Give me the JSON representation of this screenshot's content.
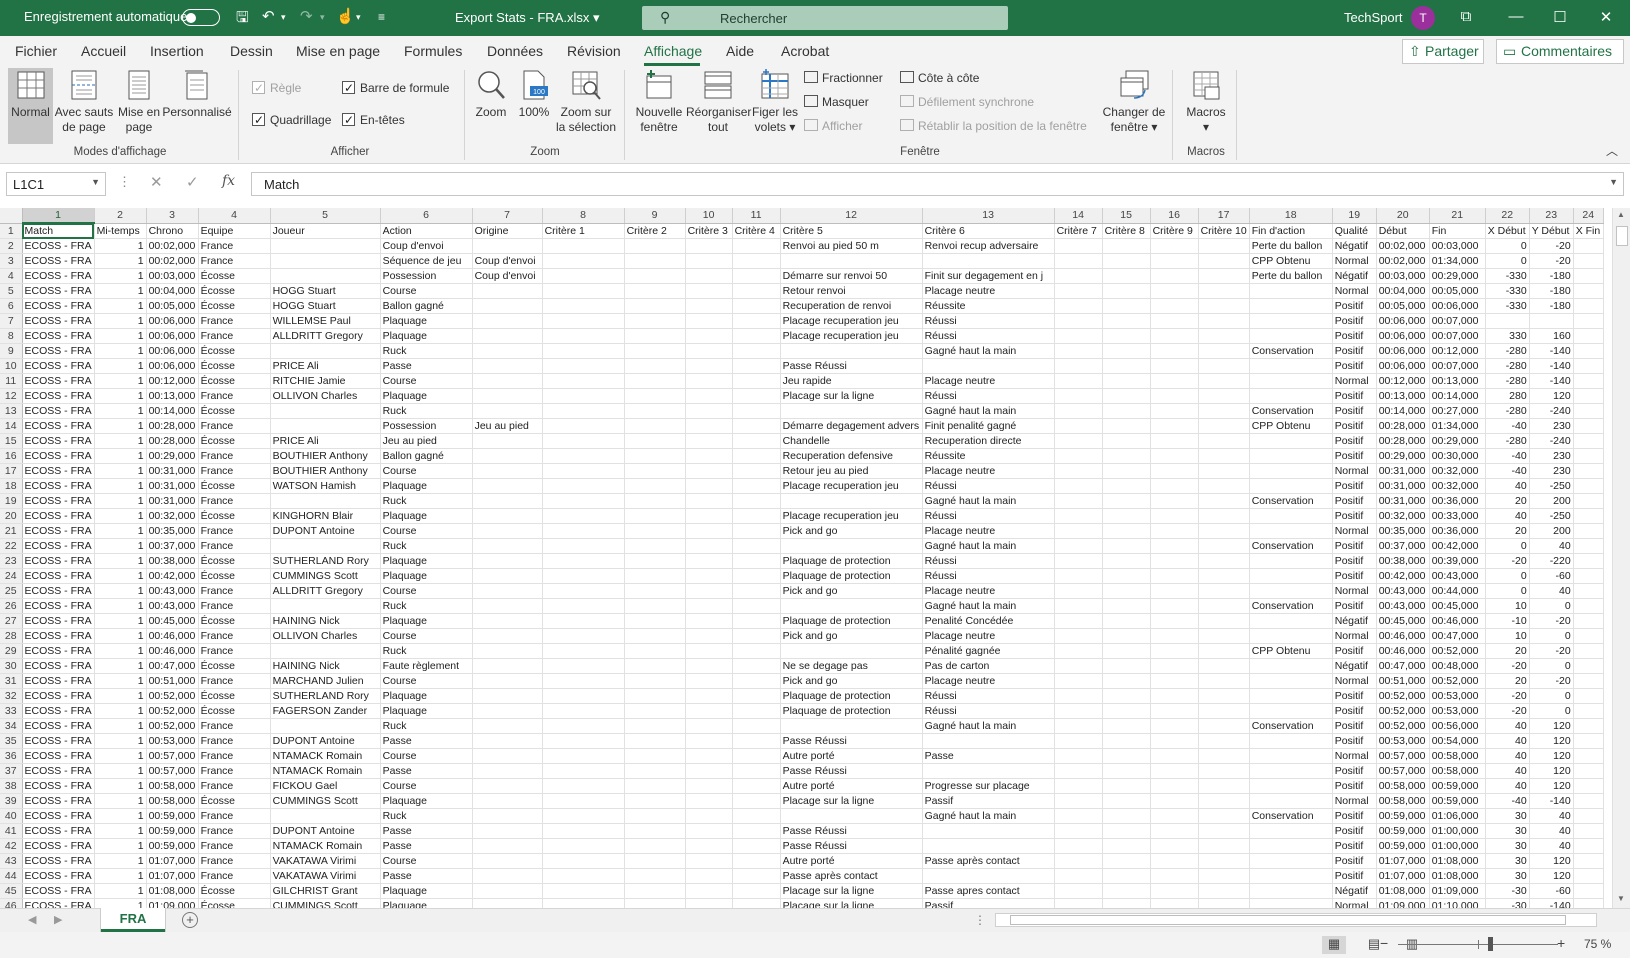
{
  "titlebar": {
    "autosave_label": "Enregistrement automatique",
    "filename": "Export Stats - FRA.xlsx",
    "search_placeholder": "Rechercher",
    "user_name": "TechSport",
    "avatar_initial": "T"
  },
  "tabs": [
    "Fichier",
    "Accueil",
    "Insertion",
    "Dessin",
    "Mise en page",
    "Formules",
    "Données",
    "Révision",
    "Affichage",
    "Aide",
    "Acrobat"
  ],
  "active_tab": "Affichage",
  "share_label": "Partager",
  "comments_label": "Commentaires",
  "ribbon": {
    "modes": {
      "normal": "Normal",
      "page_break_1": "Avec sauts",
      "page_break_2": "de page",
      "layout_1": "Mise en",
      "layout_2": "page",
      "custom": "Personnalisé",
      "group": "Modes d'affichage"
    },
    "show": {
      "regle": "Règle",
      "barre": "Barre de formule",
      "quadrillage": "Quadrillage",
      "entetes": "En-têtes",
      "group": "Afficher"
    },
    "zoom": {
      "zoom": "Zoom",
      "hundred": "100%",
      "selection_1": "Zoom sur",
      "selection_2": "la sélection",
      "group": "Zoom"
    },
    "window": {
      "new_1": "Nouvelle",
      "new_2": "fenêtre",
      "arrange_1": "Réorganiser",
      "arrange_2": "tout",
      "freeze_1": "Figer les",
      "freeze_2": "volets",
      "split": "Fractionner",
      "hide": "Masquer",
      "unhide": "Afficher",
      "side": "Côte à côte",
      "sync": "Défilement synchrone",
      "reset": "Rétablir la position de la fenêtre",
      "switch_1": "Changer de",
      "switch_2": "fenêtre",
      "group": "Fenêtre"
    },
    "macros": {
      "label": "Macros",
      "group": "Macros"
    }
  },
  "formula_bar": {
    "name_box": "L1C1",
    "value": "Match"
  },
  "columns": [
    "1",
    "2",
    "3",
    "4",
    "5",
    "6",
    "7",
    "8",
    "9",
    "10",
    "11",
    "12",
    "13",
    "14",
    "15",
    "16",
    "17",
    "18",
    "19",
    "20",
    "21",
    "22",
    "23",
    "24"
  ],
  "rows": [
    [
      "Match",
      "Mi-temps",
      "Chrono",
      "Equipe",
      "Joueur",
      "Action",
      "Origine",
      "Critère 1",
      "Critère 2",
      "Critère 3",
      "Critère 4",
      "Critère 5",
      "Critère 6",
      "Critère 7",
      "Critère 8",
      "Critère 9",
      "Critère 10",
      "Fin d'action",
      "Qualité",
      "Début",
      "Fin",
      "X Début",
      "Y Début",
      "X Fin"
    ],
    [
      "ECOSS - FRA",
      "1",
      "00:02,000",
      "France",
      "",
      "Coup d'envoi",
      "",
      "",
      "",
      "",
      "",
      "Renvoi au pied 50 m",
      "Renvoi recup adversaire",
      "",
      "",
      "",
      "",
      "Perte du ballon",
      "Négatif",
      "00:02,000",
      "00:03,000",
      "0",
      "-20",
      ""
    ],
    [
      "ECOSS - FRA",
      "1",
      "00:02,000",
      "France",
      "",
      "Séquence de jeu",
      "Coup d'envoi",
      "",
      "",
      "",
      "",
      "",
      "",
      "",
      "",
      "",
      "",
      "CPP Obtenu",
      "Normal",
      "00:02,000",
      "01:34,000",
      "0",
      "-20",
      ""
    ],
    [
      "ECOSS - FRA",
      "1",
      "00:03,000",
      "Écosse",
      "",
      "Possession",
      "Coup d'envoi",
      "",
      "",
      "",
      "",
      "Démarre sur renvoi 50",
      "Finit sur degagement en j",
      "",
      "",
      "",
      "",
      "Perte du ballon",
      "Négatif",
      "00:03,000",
      "00:29,000",
      "-330",
      "-180",
      ""
    ],
    [
      "ECOSS - FRA",
      "1",
      "00:04,000",
      "Écosse",
      "HOGG Stuart",
      "Course",
      "",
      "",
      "",
      "",
      "",
      "Retour renvoi",
      "Placage neutre",
      "",
      "",
      "",
      "",
      "",
      "Normal",
      "00:04,000",
      "00:05,000",
      "-330",
      "-180",
      ""
    ],
    [
      "ECOSS - FRA",
      "1",
      "00:05,000",
      "Écosse",
      "HOGG Stuart",
      "Ballon gagné",
      "",
      "",
      "",
      "",
      "",
      "Recuperation de renvoi",
      "Réussite",
      "",
      "",
      "",
      "",
      "",
      "Positif",
      "00:05,000",
      "00:06,000",
      "-330",
      "-180",
      ""
    ],
    [
      "ECOSS - FRA",
      "1",
      "00:06,000",
      "France",
      "WILLEMSE Paul",
      "Plaquage",
      "",
      "",
      "",
      "",
      "",
      "Placage recuperation jeu",
      "Réussi",
      "",
      "",
      "",
      "",
      "",
      "Positif",
      "00:06,000",
      "00:07,000",
      "",
      ""
    ],
    [
      "ECOSS - FRA",
      "1",
      "00:06,000",
      "France",
      "ALLDRITT Gregory",
      "Plaquage",
      "",
      "",
      "",
      "",
      "",
      "Placage recuperation jeu",
      "Réussi",
      "",
      "",
      "",
      "",
      "",
      "Positif",
      "00:06,000",
      "00:07,000",
      "330",
      "160",
      ""
    ],
    [
      "ECOSS - FRA",
      "1",
      "00:06,000",
      "Écosse",
      "",
      "Ruck",
      "",
      "",
      "",
      "",
      "",
      "",
      "Gagné haut la main",
      "",
      "",
      "",
      "",
      "Conservation",
      "Positif",
      "00:06,000",
      "00:12,000",
      "-280",
      "-140",
      ""
    ],
    [
      "ECOSS - FRA",
      "1",
      "00:06,000",
      "Écosse",
      "PRICE Ali",
      "Passe",
      "",
      "",
      "",
      "",
      "",
      "Passe Réussi",
      "",
      "",
      "",
      "",
      "",
      "",
      "Positif",
      "00:06,000",
      "00:07,000",
      "-280",
      "-140",
      ""
    ],
    [
      "ECOSS - FRA",
      "1",
      "00:12,000",
      "Écosse",
      "RITCHIE Jamie",
      "Course",
      "",
      "",
      "",
      "",
      "",
      "Jeu rapide",
      "Placage neutre",
      "",
      "",
      "",
      "",
      "",
      "Normal",
      "00:12,000",
      "00:13,000",
      "-280",
      "-140",
      ""
    ],
    [
      "ECOSS - FRA",
      "1",
      "00:13,000",
      "France",
      "OLLIVON Charles",
      "Plaquage",
      "",
      "",
      "",
      "",
      "",
      "Placage sur la ligne",
      "Réussi",
      "",
      "",
      "",
      "",
      "",
      "Positif",
      "00:13,000",
      "00:14,000",
      "280",
      "120",
      ""
    ],
    [
      "ECOSS - FRA",
      "1",
      "00:14,000",
      "Écosse",
      "",
      "Ruck",
      "",
      "",
      "",
      "",
      "",
      "",
      "Gagné haut la main",
      "",
      "",
      "",
      "",
      "Conservation",
      "Positif",
      "00:14,000",
      "00:27,000",
      "-280",
      "-240",
      ""
    ],
    [
      "ECOSS - FRA",
      "1",
      "00:28,000",
      "France",
      "",
      "Possession",
      "Jeu au pied",
      "",
      "",
      "",
      "",
      "Démarre degagement advers",
      "Finit penalité gagné",
      "",
      "",
      "",
      "",
      "CPP Obtenu",
      "Positif",
      "00:28,000",
      "01:34,000",
      "-40",
      "230",
      ""
    ],
    [
      "ECOSS - FRA",
      "1",
      "00:28,000",
      "Écosse",
      "PRICE Ali",
      "Jeu au pied",
      "",
      "",
      "",
      "",
      "",
      "Chandelle",
      "Recuperation directe",
      "",
      "",
      "",
      "",
      "",
      "Positif",
      "00:28,000",
      "00:29,000",
      "-280",
      "-240",
      ""
    ],
    [
      "ECOSS - FRA",
      "1",
      "00:29,000",
      "France",
      "BOUTHIER Anthony",
      "Ballon gagné",
      "",
      "",
      "",
      "",
      "",
      "Recuperation defensive",
      "Réussite",
      "",
      "",
      "",
      "",
      "",
      "Positif",
      "00:29,000",
      "00:30,000",
      "-40",
      "230",
      ""
    ],
    [
      "ECOSS - FRA",
      "1",
      "00:31,000",
      "France",
      "BOUTHIER Anthony",
      "Course",
      "",
      "",
      "",
      "",
      "",
      "Retour jeu au pied",
      "Placage neutre",
      "",
      "",
      "",
      "",
      "",
      "Normal",
      "00:31,000",
      "00:32,000",
      "-40",
      "230",
      ""
    ],
    [
      "ECOSS - FRA",
      "1",
      "00:31,000",
      "Écosse",
      "WATSON Hamish",
      "Plaquage",
      "",
      "",
      "",
      "",
      "",
      "Placage recuperation jeu",
      "Réussi",
      "",
      "",
      "",
      "",
      "",
      "Positif",
      "00:31,000",
      "00:32,000",
      "40",
      "-250",
      ""
    ],
    [
      "ECOSS - FRA",
      "1",
      "00:31,000",
      "France",
      "",
      "Ruck",
      "",
      "",
      "",
      "",
      "",
      "",
      "Gagné haut la main",
      "",
      "",
      "",
      "",
      "Conservation",
      "Positif",
      "00:31,000",
      "00:36,000",
      "20",
      "200",
      ""
    ],
    [
      "ECOSS - FRA",
      "1",
      "00:32,000",
      "Écosse",
      "KINGHORN Blair",
      "Plaquage",
      "",
      "",
      "",
      "",
      "",
      "Placage recuperation jeu",
      "Réussi",
      "",
      "",
      "",
      "",
      "",
      "Positif",
      "00:32,000",
      "00:33,000",
      "40",
      "-250",
      ""
    ],
    [
      "ECOSS - FRA",
      "1",
      "00:35,000",
      "France",
      "DUPONT Antoine",
      "Course",
      "",
      "",
      "",
      "",
      "",
      "Pick and go",
      "Placage neutre",
      "",
      "",
      "",
      "",
      "",
      "Normal",
      "00:35,000",
      "00:36,000",
      "20",
      "200",
      ""
    ],
    [
      "ECOSS - FRA",
      "1",
      "00:37,000",
      "France",
      "",
      "Ruck",
      "",
      "",
      "",
      "",
      "",
      "",
      "Gagné haut la main",
      "",
      "",
      "",
      "",
      "Conservation",
      "Positif",
      "00:37,000",
      "00:42,000",
      "0",
      "40",
      ""
    ],
    [
      "ECOSS - FRA",
      "1",
      "00:38,000",
      "Écosse",
      "SUTHERLAND Rory",
      "Plaquage",
      "",
      "",
      "",
      "",
      "",
      "Plaquage de protection",
      "Réussi",
      "",
      "",
      "",
      "",
      "",
      "Positif",
      "00:38,000",
      "00:39,000",
      "-20",
      "-220",
      ""
    ],
    [
      "ECOSS - FRA",
      "1",
      "00:42,000",
      "Écosse",
      "CUMMINGS Scott",
      "Plaquage",
      "",
      "",
      "",
      "",
      "",
      "Plaquage de protection",
      "Réussi",
      "",
      "",
      "",
      "",
      "",
      "Positif",
      "00:42,000",
      "00:43,000",
      "0",
      "-60",
      ""
    ],
    [
      "ECOSS - FRA",
      "1",
      "00:43,000",
      "France",
      "ALLDRITT Gregory",
      "Course",
      "",
      "",
      "",
      "",
      "",
      "Pick and go",
      "Placage neutre",
      "",
      "",
      "",
      "",
      "",
      "Normal",
      "00:43,000",
      "00:44,000",
      "0",
      "40",
      ""
    ],
    [
      "ECOSS - FRA",
      "1",
      "00:43,000",
      "France",
      "",
      "Ruck",
      "",
      "",
      "",
      "",
      "",
      "",
      "Gagné haut la main",
      "",
      "",
      "",
      "",
      "Conservation",
      "Positif",
      "00:43,000",
      "00:45,000",
      "10",
      "0",
      ""
    ],
    [
      "ECOSS - FRA",
      "1",
      "00:45,000",
      "Écosse",
      "HAINING Nick",
      "Plaquage",
      "",
      "",
      "",
      "",
      "",
      "Plaquage de protection",
      "Penalité Concédée",
      "",
      "",
      "",
      "",
      "",
      "Négatif",
      "00:45,000",
      "00:46,000",
      "-10",
      "-20",
      ""
    ],
    [
      "ECOSS - FRA",
      "1",
      "00:46,000",
      "France",
      "OLLIVON Charles",
      "Course",
      "",
      "",
      "",
      "",
      "",
      "Pick and go",
      "Placage neutre",
      "",
      "",
      "",
      "",
      "",
      "Normal",
      "00:46,000",
      "00:47,000",
      "10",
      "0",
      ""
    ],
    [
      "ECOSS - FRA",
      "1",
      "00:46,000",
      "France",
      "",
      "Ruck",
      "",
      "",
      "",
      "",
      "",
      "",
      "Pénalité gagnée",
      "",
      "",
      "",
      "",
      "CPP Obtenu",
      "Positif",
      "00:46,000",
      "00:52,000",
      "20",
      "-20",
      ""
    ],
    [
      "ECOSS - FRA",
      "1",
      "00:47,000",
      "Écosse",
      "HAINING Nick",
      "Faute règlement",
      "",
      "",
      "",
      "",
      "",
      "Ne se degage pas",
      "Pas de carton",
      "",
      "",
      "",
      "",
      "",
      "Négatif",
      "00:47,000",
      "00:48,000",
      "-20",
      "0",
      ""
    ],
    [
      "ECOSS - FRA",
      "1",
      "00:51,000",
      "France",
      "MARCHAND Julien",
      "Course",
      "",
      "",
      "",
      "",
      "",
      "Pick and go",
      "Placage neutre",
      "",
      "",
      "",
      "",
      "",
      "Normal",
      "00:51,000",
      "00:52,000",
      "20",
      "-20",
      ""
    ],
    [
      "ECOSS - FRA",
      "1",
      "00:52,000",
      "Écosse",
      "SUTHERLAND Rory",
      "Plaquage",
      "",
      "",
      "",
      "",
      "",
      "Plaquage de protection",
      "Réussi",
      "",
      "",
      "",
      "",
      "",
      "Positif",
      "00:52,000",
      "00:53,000",
      "-20",
      "0",
      ""
    ],
    [
      "ECOSS - FRA",
      "1",
      "00:52,000",
      "Écosse",
      "FAGERSON Zander",
      "Plaquage",
      "",
      "",
      "",
      "",
      "",
      "Plaquage de protection",
      "Réussi",
      "",
      "",
      "",
      "",
      "",
      "Positif",
      "00:52,000",
      "00:53,000",
      "-20",
      "0",
      ""
    ],
    [
      "ECOSS - FRA",
      "1",
      "00:52,000",
      "France",
      "",
      "Ruck",
      "",
      "",
      "",
      "",
      "",
      "",
      "Gagné haut la main",
      "",
      "",
      "",
      "",
      "Conservation",
      "Positif",
      "00:52,000",
      "00:56,000",
      "40",
      "120",
      ""
    ],
    [
      "ECOSS - FRA",
      "1",
      "00:53,000",
      "France",
      "DUPONT Antoine",
      "Passe",
      "",
      "",
      "",
      "",
      "",
      "Passe Réussi",
      "",
      "",
      "",
      "",
      "",
      "",
      "Positif",
      "00:53,000",
      "00:54,000",
      "40",
      "120",
      ""
    ],
    [
      "ECOSS - FRA",
      "1",
      "00:57,000",
      "France",
      "NTAMACK Romain",
      "Course",
      "",
      "",
      "",
      "",
      "",
      "Autre porté",
      "Passe",
      "",
      "",
      "",
      "",
      "",
      "Normal",
      "00:57,000",
      "00:58,000",
      "40",
      "120",
      ""
    ],
    [
      "ECOSS - FRA",
      "1",
      "00:57,000",
      "France",
      "NTAMACK Romain",
      "Passe",
      "",
      "",
      "",
      "",
      "",
      "Passe Réussi",
      "",
      "",
      "",
      "",
      "",
      "",
      "Positif",
      "00:57,000",
      "00:58,000",
      "40",
      "120",
      ""
    ],
    [
      "ECOSS - FRA",
      "1",
      "00:58,000",
      "France",
      "FICKOU Gael",
      "Course",
      "",
      "",
      "",
      "",
      "",
      "Autre porté",
      "Progresse sur placage",
      "",
      "",
      "",
      "",
      "",
      "Positif",
      "00:58,000",
      "00:59,000",
      "40",
      "120",
      ""
    ],
    [
      "ECOSS - FRA",
      "1",
      "00:58,000",
      "Écosse",
      "CUMMINGS Scott",
      "Plaquage",
      "",
      "",
      "",
      "",
      "",
      "Placage sur la ligne",
      "Passif",
      "",
      "",
      "",
      "",
      "",
      "Normal",
      "00:58,000",
      "00:59,000",
      "-40",
      "-140",
      ""
    ],
    [
      "ECOSS - FRA",
      "1",
      "00:59,000",
      "France",
      "",
      "Ruck",
      "",
      "",
      "",
      "",
      "",
      "",
      "Gagné haut la main",
      "",
      "",
      "",
      "",
      "Conservation",
      "Positif",
      "00:59,000",
      "01:06,000",
      "30",
      "40",
      ""
    ],
    [
      "ECOSS - FRA",
      "1",
      "00:59,000",
      "France",
      "DUPONT Antoine",
      "Passe",
      "",
      "",
      "",
      "",
      "",
      "Passe Réussi",
      "",
      "",
      "",
      "",
      "",
      "",
      "Positif",
      "00:59,000",
      "01:00,000",
      "30",
      "40",
      ""
    ],
    [
      "ECOSS - FRA",
      "1",
      "00:59,000",
      "France",
      "NTAMACK Romain",
      "Passe",
      "",
      "",
      "",
      "",
      "",
      "Passe Réussi",
      "",
      "",
      "",
      "",
      "",
      "",
      "Positif",
      "00:59,000",
      "01:00,000",
      "30",
      "40",
      ""
    ],
    [
      "ECOSS - FRA",
      "1",
      "01:07,000",
      "France",
      "VAKATAWA Virimi",
      "Course",
      "",
      "",
      "",
      "",
      "",
      "Autre porté",
      "Passe après contact",
      "",
      "",
      "",
      "",
      "",
      "Positif",
      "01:07,000",
      "01:08,000",
      "30",
      "120",
      ""
    ],
    [
      "ECOSS - FRA",
      "1",
      "01:07,000",
      "France",
      "VAKATAWA Virimi",
      "Passe",
      "",
      "",
      "",
      "",
      "",
      "Passe après contact",
      "",
      "",
      "",
      "",
      "",
      "",
      "Positif",
      "01:07,000",
      "01:08,000",
      "30",
      "120",
      ""
    ],
    [
      "ECOSS - FRA",
      "1",
      "01:08,000",
      "Écosse",
      "GILCHRIST Grant",
      "Plaquage",
      "",
      "",
      "",
      "",
      "",
      "Placage sur la ligne",
      "Passe apres contact",
      "",
      "",
      "",
      "",
      "",
      "Négatif",
      "01:08,000",
      "01:09,000",
      "-30",
      "-60",
      ""
    ],
    [
      "ECOSS - FRA",
      "1",
      "01:09,000",
      "Écosse",
      "CUMMINGS Scott",
      "Plaquage",
      "",
      "",
      "",
      "",
      "",
      "Placage sur la ligne",
      "Passif",
      "",
      "",
      "",
      "",
      "",
      "Normal",
      "01:09,000",
      "01:10,000",
      "-30",
      "-140",
      ""
    ]
  ],
  "sheet_tab": "FRA",
  "zoom_level": "75 %"
}
